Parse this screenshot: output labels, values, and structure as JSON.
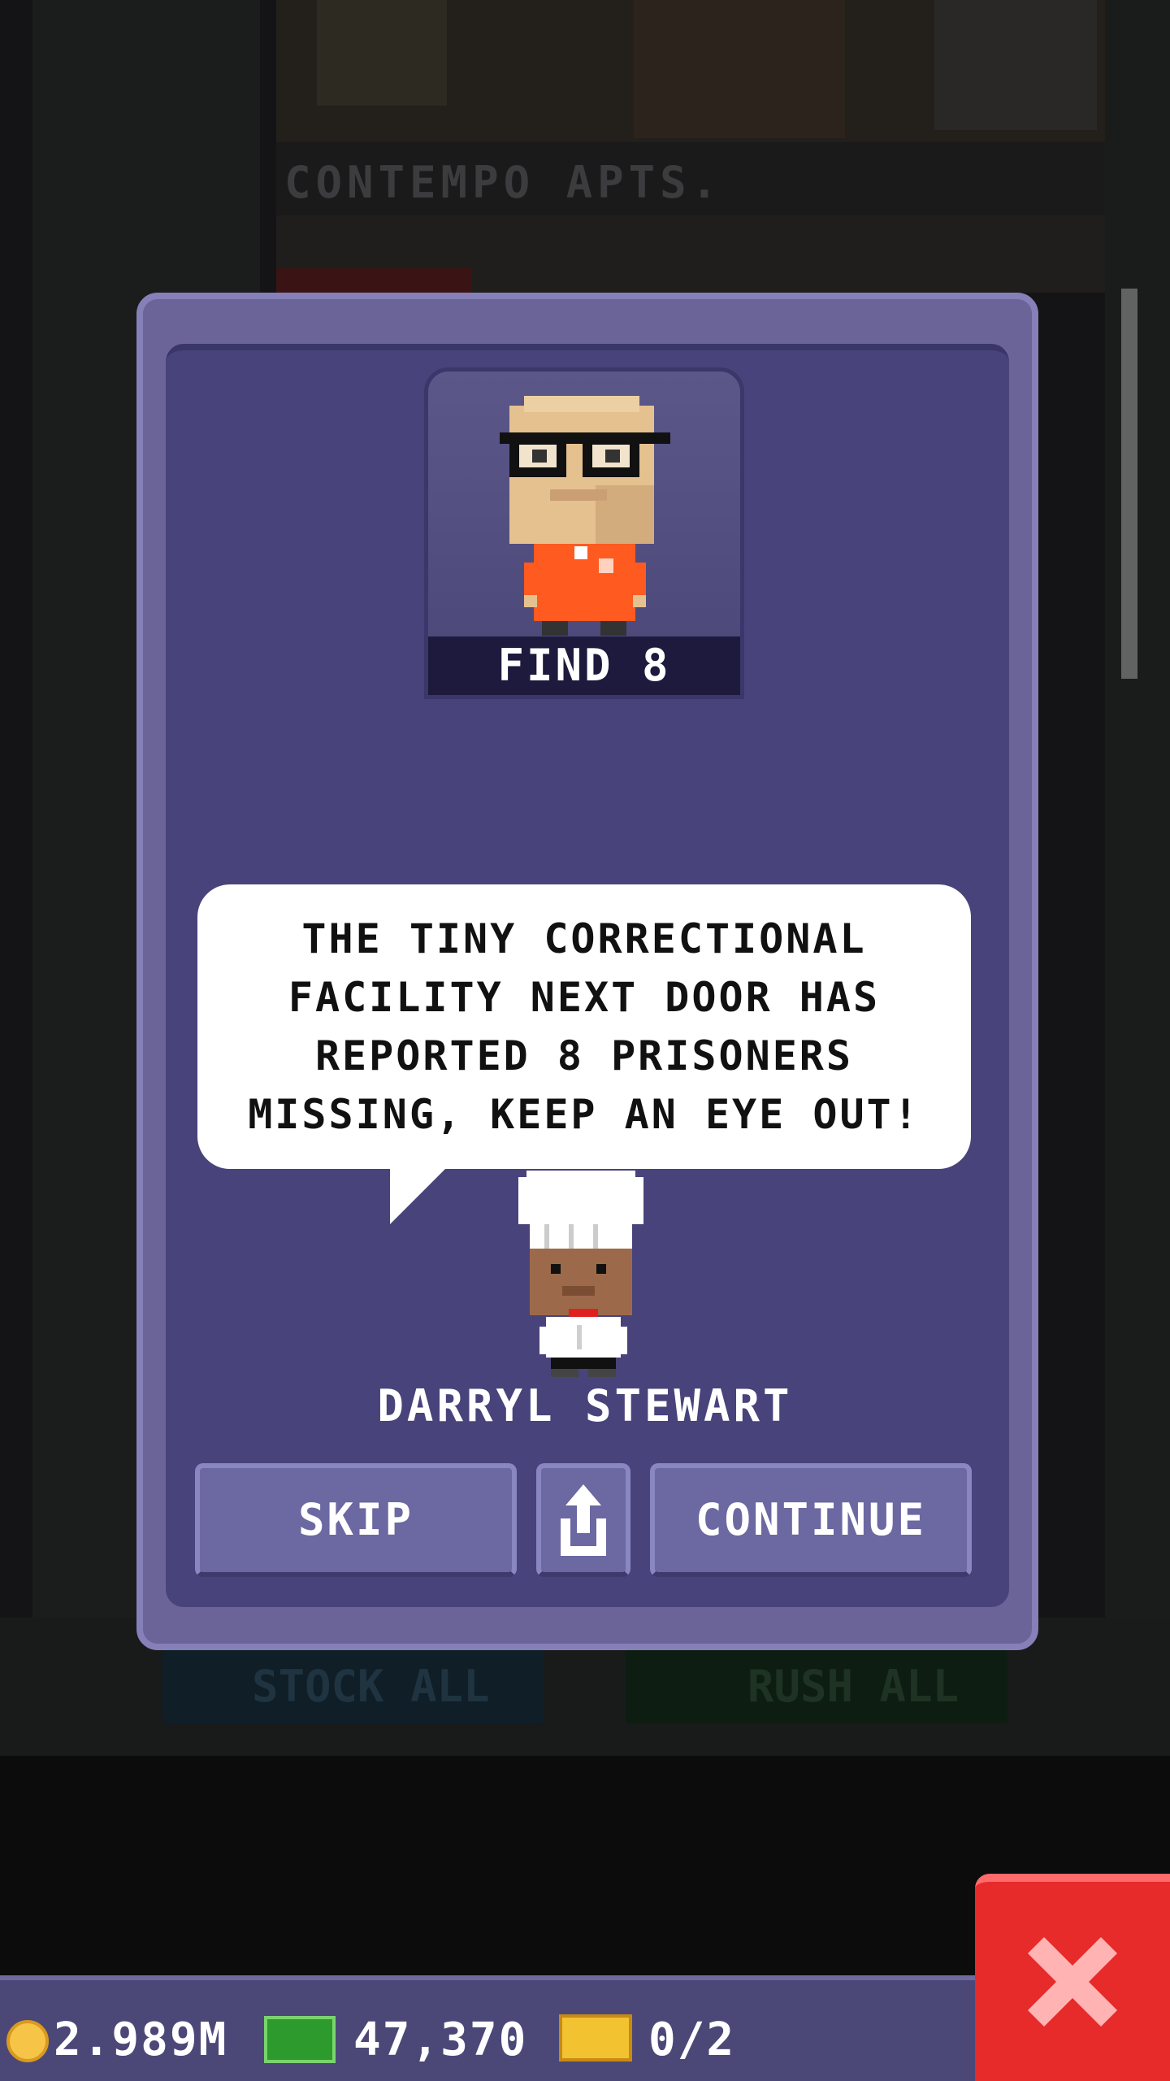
{
  "background": {
    "floor_label": "CONTEMPO APTS.",
    "stock_all_label": "STOCK ALL",
    "rush_all_label": "RUSH ALL"
  },
  "dialog": {
    "find_label": "FIND 8",
    "speech": "THE TINY CORRECTIONAL\nFACILITY NEXT DOOR HAS\nREPORTED 8 PRISONERS\nMISSING, KEEP AN EYE OUT!",
    "speaker_name": "DARRYL STEWART",
    "buttons": {
      "skip": "SKIP",
      "share_icon": "share-icon",
      "continue": "CONTINUE"
    }
  },
  "status_bar": {
    "coins": "2.989M",
    "cash": "47,370",
    "bux": "0/2"
  },
  "colors": {
    "dialog_bg": "#48437a",
    "dialog_border": "#6a6498",
    "close_button": "#e72a2a",
    "prisoner_orange": "#ff5a1f"
  }
}
